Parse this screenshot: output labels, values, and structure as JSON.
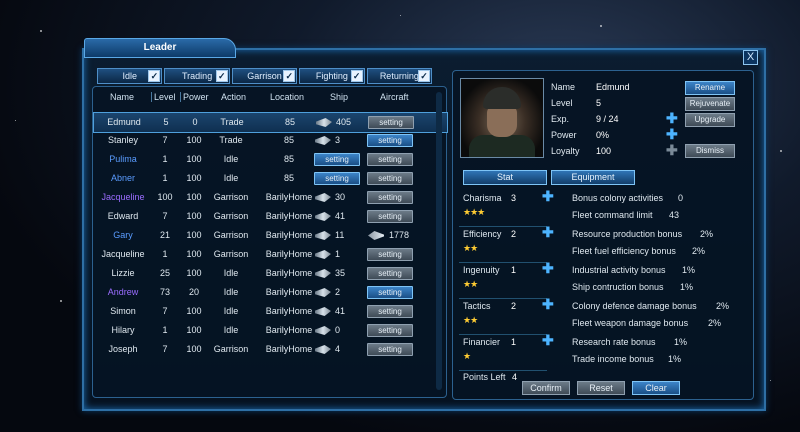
{
  "window": {
    "title": "Leader",
    "close_label": "X"
  },
  "filters": [
    {
      "label": "Idle",
      "check": "✓"
    },
    {
      "label": "Trading",
      "check": "✓"
    },
    {
      "label": "Garrison",
      "check": "✓"
    },
    {
      "label": "Fighting",
      "check": "✓"
    },
    {
      "label": "Returning",
      "check": "✓"
    }
  ],
  "columns": {
    "name": "Name",
    "level": "Level",
    "power": "Power",
    "action": "Action",
    "location": "Location",
    "ship": "Ship",
    "aircraft": "Aircraft"
  },
  "rows": [
    {
      "name": "Edmund",
      "level": "5",
      "power": "0",
      "action": "Trade",
      "location": "85",
      "ship": "405",
      "aircraft": "setting"
    },
    {
      "name": "Stanley",
      "level": "7",
      "power": "100",
      "action": "Trade",
      "location": "85",
      "ship": "3",
      "aircraft": "setting"
    },
    {
      "name": "Pulima",
      "level": "1",
      "power": "100",
      "action": "Idle",
      "location": "85",
      "ship": "setting",
      "aircraft": "setting"
    },
    {
      "name": "Abner",
      "level": "1",
      "power": "100",
      "action": "Idle",
      "location": "85",
      "ship": "setting",
      "aircraft": "setting"
    },
    {
      "name": "Jacqueline",
      "level": "100",
      "power": "100",
      "action": "Garrison",
      "location": "BarilyHome",
      "ship": "30",
      "aircraft": "setting"
    },
    {
      "name": "Edward",
      "level": "7",
      "power": "100",
      "action": "Garrison",
      "location": "BarilyHome",
      "ship": "41",
      "aircraft": "setting"
    },
    {
      "name": "Gary",
      "level": "21",
      "power": "100",
      "action": "Garrison",
      "location": "BarilyHome",
      "ship": "11",
      "aircraft": "1778"
    },
    {
      "name": "Jacqueline",
      "level": "1",
      "power": "100",
      "action": "Garrison",
      "location": "BarilyHome",
      "ship": "1",
      "aircraft": "setting"
    },
    {
      "name": "Lizzie",
      "level": "25",
      "power": "100",
      "action": "Idle",
      "location": "BarilyHome",
      "ship": "35",
      "aircraft": "setting"
    },
    {
      "name": "Andrew",
      "level": "73",
      "power": "20",
      "action": "Idle",
      "location": "BarilyHome",
      "ship": "2",
      "aircraft": "setting"
    },
    {
      "name": "Simon",
      "level": "7",
      "power": "100",
      "action": "Idle",
      "location": "BarilyHome",
      "ship": "41",
      "aircraft": "setting"
    },
    {
      "name": "Hilary",
      "level": "1",
      "power": "100",
      "action": "Idle",
      "location": "BarilyHome",
      "ship": "0",
      "aircraft": "setting"
    },
    {
      "name": "Joseph",
      "level": "7",
      "power": "100",
      "action": "Garrison",
      "location": "BarilyHome",
      "ship": "4",
      "aircraft": "setting"
    }
  ],
  "leader": {
    "name_label": "Name",
    "name": "Edmund",
    "level_label": "Level",
    "level": "5",
    "exp_label": "Exp.",
    "exp": "9 / 24",
    "power_label": "Power",
    "power": "0%",
    "loyalty_label": "Loyalty",
    "loyalty": "100"
  },
  "actions": {
    "rename": "Rename",
    "rejuvenate": "Rejuvenate",
    "upgrade": "Upgrade",
    "dismiss": "Dismiss"
  },
  "tabs": {
    "stat": "Stat",
    "equipment": "Equipment"
  },
  "stats": [
    {
      "name": "Charisma",
      "value": "3",
      "stars": "★★★",
      "bonuses": [
        {
          "label": "Bonus colony activities",
          "value": "0"
        },
        {
          "label": "Fleet command limit",
          "value": "43"
        }
      ]
    },
    {
      "name": "Efficiency",
      "value": "2",
      "stars": "★★",
      "bonuses": [
        {
          "label": "Resource production bonus",
          "value": "2%"
        },
        {
          "label": "Fleet fuel efficiency bonus",
          "value": "2%"
        }
      ]
    },
    {
      "name": "Ingenuity",
      "value": "1",
      "stars": "★★",
      "bonuses": [
        {
          "label": "Industrial activity bonus",
          "value": "1%"
        },
        {
          "label": "Ship contruction bonus",
          "value": "1%"
        }
      ]
    },
    {
      "name": "Tactics",
      "value": "2",
      "stars": "★★",
      "bonuses": [
        {
          "label": "Colony defence damage bonus",
          "value": "2%"
        },
        {
          "label": "Fleet weapon damage bonus",
          "value": "2%"
        }
      ]
    },
    {
      "name": "Financier",
      "value": "1",
      "stars": "★",
      "bonuses": [
        {
          "label": "Research rate bonus",
          "value": "1%"
        },
        {
          "label": "Trade income bonus",
          "value": "1%"
        }
      ]
    }
  ],
  "points_left_label": "Points Left",
  "points_left": "4",
  "bottom_buttons": {
    "confirm": "Confirm",
    "reset": "Reset",
    "clear": "Clear"
  }
}
